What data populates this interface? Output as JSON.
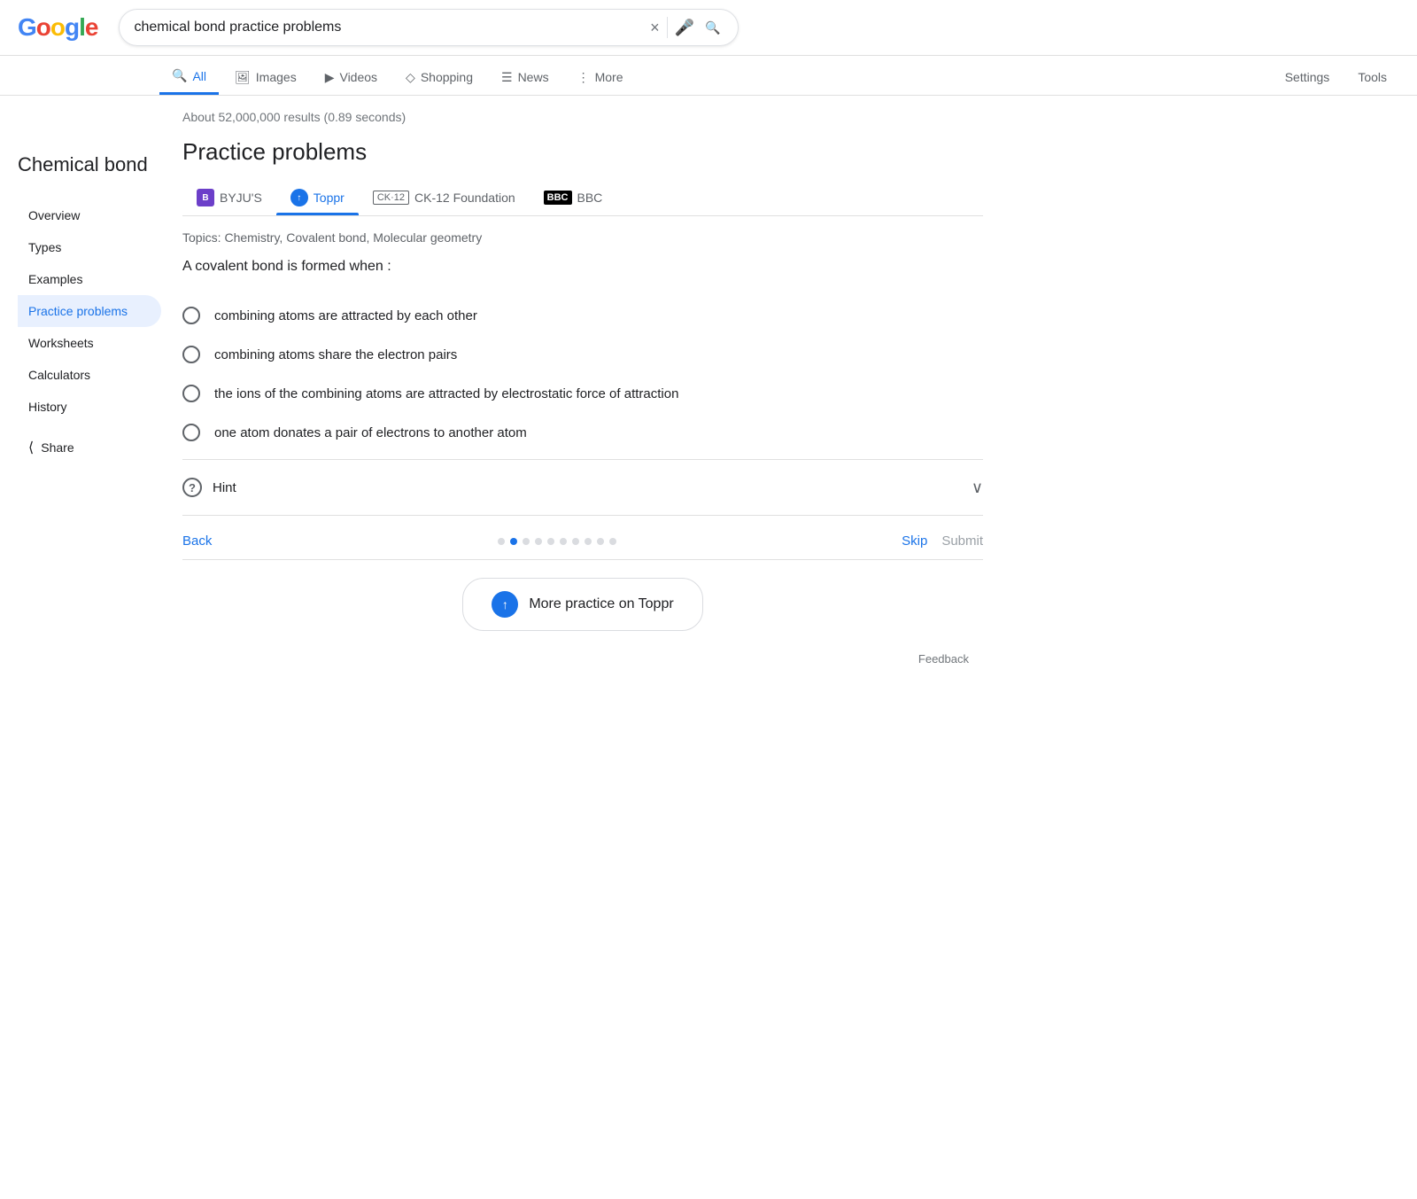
{
  "logo": {
    "g1": "G",
    "o1": "o",
    "o2": "o",
    "g2": "g",
    "l": "l",
    "e": "e"
  },
  "search": {
    "query": "chemical bond practice problems",
    "clear_label": "×",
    "mic_label": "🎤",
    "search_label": "🔍"
  },
  "tabs": {
    "items": [
      {
        "id": "all",
        "label": "All",
        "icon": "🔍",
        "active": true
      },
      {
        "id": "images",
        "label": "Images",
        "icon": "🖼"
      },
      {
        "id": "videos",
        "label": "Videos",
        "icon": "▶"
      },
      {
        "id": "shopping",
        "label": "Shopping",
        "icon": "◇"
      },
      {
        "id": "news",
        "label": "News",
        "icon": "☰"
      },
      {
        "id": "more",
        "label": "More",
        "icon": "⋮"
      }
    ],
    "settings": "Settings",
    "tools": "Tools"
  },
  "results_count": "About 52,000,000 results (0.89 seconds)",
  "section_title": "Practice problems",
  "sources": [
    {
      "id": "byjus",
      "label": "BYJU'S"
    },
    {
      "id": "toppr",
      "label": "Toppr",
      "active": true
    },
    {
      "id": "ck12",
      "label": "CK-12 Foundation"
    },
    {
      "id": "bbc",
      "label": "BBC"
    }
  ],
  "topics": "Topics: Chemistry, Covalent bond, Molecular geometry",
  "question": "A covalent bond is formed when :",
  "options": [
    {
      "id": "a",
      "text": "combining atoms are attracted by each other"
    },
    {
      "id": "b",
      "text": "combining atoms share the electron pairs"
    },
    {
      "id": "c",
      "text": "the ions of the combining atoms are attracted by electrostatic force of attraction"
    },
    {
      "id": "d",
      "text": "one atom donates a pair of electrons to another atom"
    }
  ],
  "hint": {
    "label": "Hint"
  },
  "navigation": {
    "back": "Back",
    "skip": "Skip",
    "submit": "Submit",
    "dots": [
      {
        "active": false
      },
      {
        "active": true
      },
      {
        "active": false
      },
      {
        "active": false
      },
      {
        "active": false
      },
      {
        "active": false
      },
      {
        "active": false
      },
      {
        "active": false
      },
      {
        "active": false
      },
      {
        "active": false
      }
    ]
  },
  "more_practice": "More practice on Toppr",
  "sidebar": {
    "title": "Chemical bond",
    "nav_items": [
      {
        "id": "overview",
        "label": "Overview"
      },
      {
        "id": "types",
        "label": "Types"
      },
      {
        "id": "examples",
        "label": "Examples"
      },
      {
        "id": "practice",
        "label": "Practice problems",
        "active": true
      },
      {
        "id": "worksheets",
        "label": "Worksheets"
      },
      {
        "id": "calculators",
        "label": "Calculators"
      },
      {
        "id": "history",
        "label": "History"
      }
    ],
    "share": "Share"
  },
  "feedback": "Feedback"
}
